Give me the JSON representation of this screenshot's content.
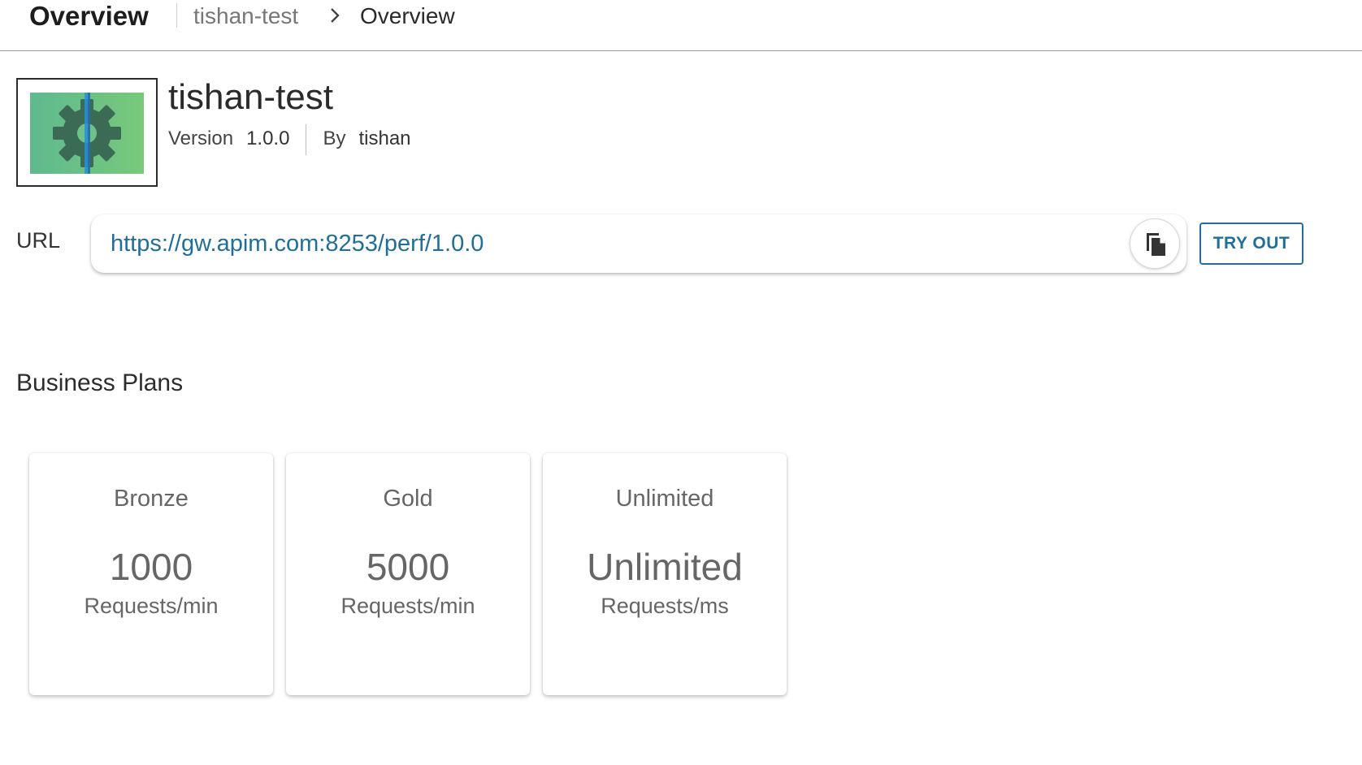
{
  "header": {
    "title": "Overview",
    "breadcrumb": {
      "api": "tishan-test",
      "current": "Overview"
    }
  },
  "api": {
    "name": "tishan-test",
    "version_label": "Version",
    "version": "1.0.0",
    "by_label": "By",
    "author": "tishan",
    "thumbnail_icon": "gear-icon"
  },
  "endpoint": {
    "label": "URL",
    "url": "https://gw.apim.com:8253/perf/1.0.0",
    "copy_icon": "copy-icon",
    "try_out_label": "TRY OUT"
  },
  "business_plans": {
    "title": "Business Plans",
    "plans": [
      {
        "name": "Bronze",
        "value": "1000",
        "unit": "Requests/min"
      },
      {
        "name": "Gold",
        "value": "5000",
        "unit": "Requests/min"
      },
      {
        "name": "Unlimited",
        "value": "Unlimited",
        "unit": "Requests/ms"
      }
    ]
  },
  "colors": {
    "link": "#1f6f9a",
    "thumb_green_left": "#5fb98f",
    "thumb_green_right": "#78c97a",
    "gear": "#3b6b55",
    "thumb_stripe": "#2a8fd6"
  }
}
